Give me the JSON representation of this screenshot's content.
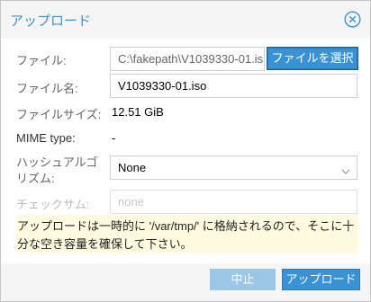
{
  "dialog": {
    "title": "アップロード",
    "close_icon": "close-circle-icon",
    "accent_color": "#3892d3"
  },
  "form": {
    "file": {
      "label": "ファイル:",
      "value": "C:\\fakepath\\V1039330-01.is",
      "button_label": "ファイルを選択"
    },
    "filename": {
      "label": "ファイル名:",
      "value": "V1039330-01.iso"
    },
    "filesize": {
      "label": "ファイルサイズ:",
      "value": "12.51 GiB"
    },
    "mime": {
      "label": "MIME type:",
      "value": "-"
    },
    "hash": {
      "label_line1": "ハッシュアルゴ",
      "label_line2": "リズム:",
      "value": "None",
      "icon": "chevron-down-icon"
    },
    "checksum": {
      "label": "チェックサム:",
      "placeholder": "none"
    }
  },
  "notice": {
    "line1": "アップロードは一時的に '/var/tmp/' に格納されるので、そこに十",
    "line2": "分な空き容量を確保して下さい。",
    "background": "#fffbe0"
  },
  "footer": {
    "cancel_label": "中止",
    "upload_label": "アップロード"
  }
}
